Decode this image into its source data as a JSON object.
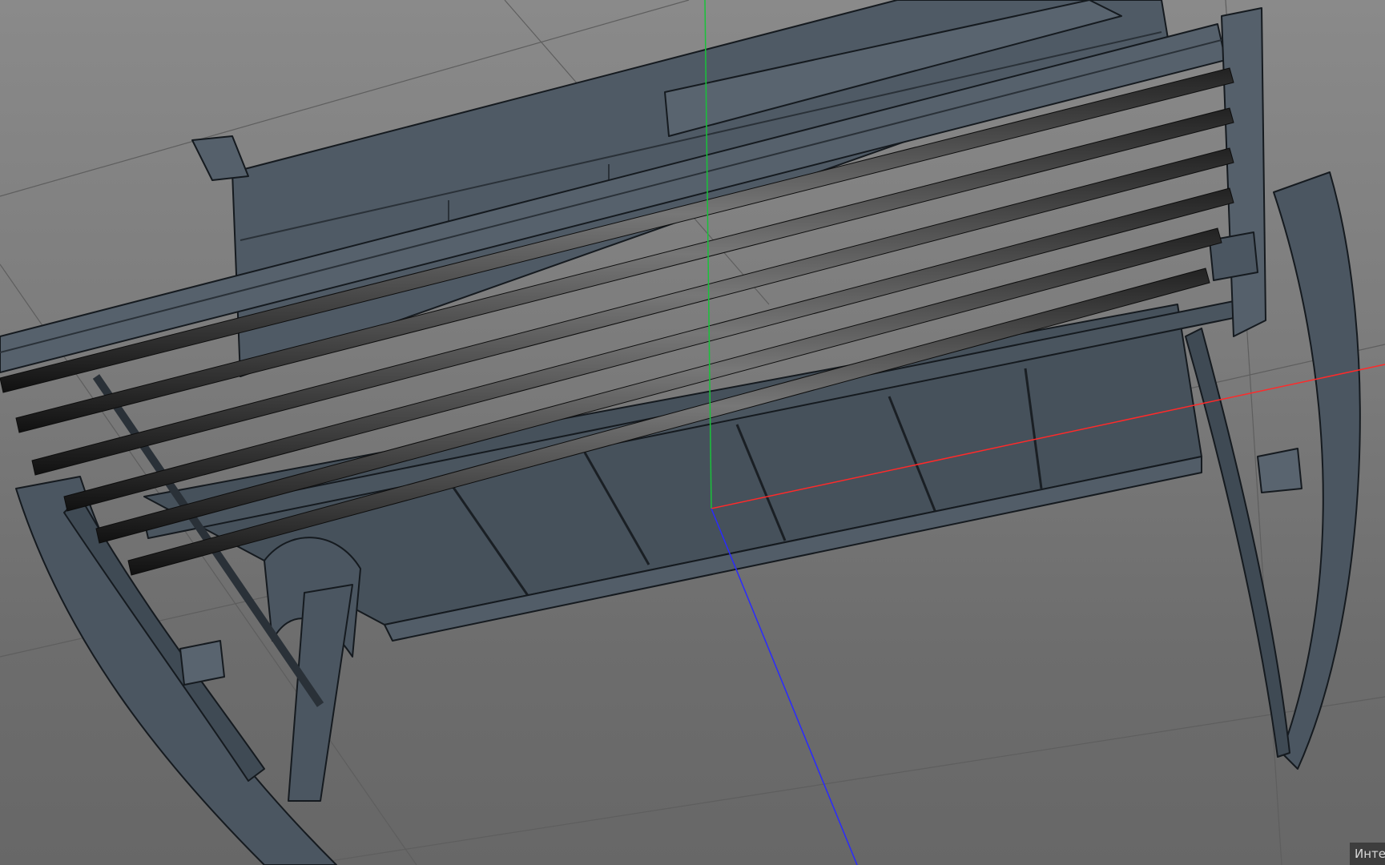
{
  "app": {
    "type": "3d-viewport"
  },
  "viewport": {
    "background_color": "#7a7a7a",
    "grid_color": "#5e5e5e",
    "model_color": "#4b5661",
    "model_edge_color": "#151a1f",
    "axes": {
      "x_color": "#ff2a2a",
      "y_color": "#19c23a",
      "z_color": "#2a2aff"
    },
    "object": "bench-model"
  },
  "status": {
    "label": "Инте"
  }
}
